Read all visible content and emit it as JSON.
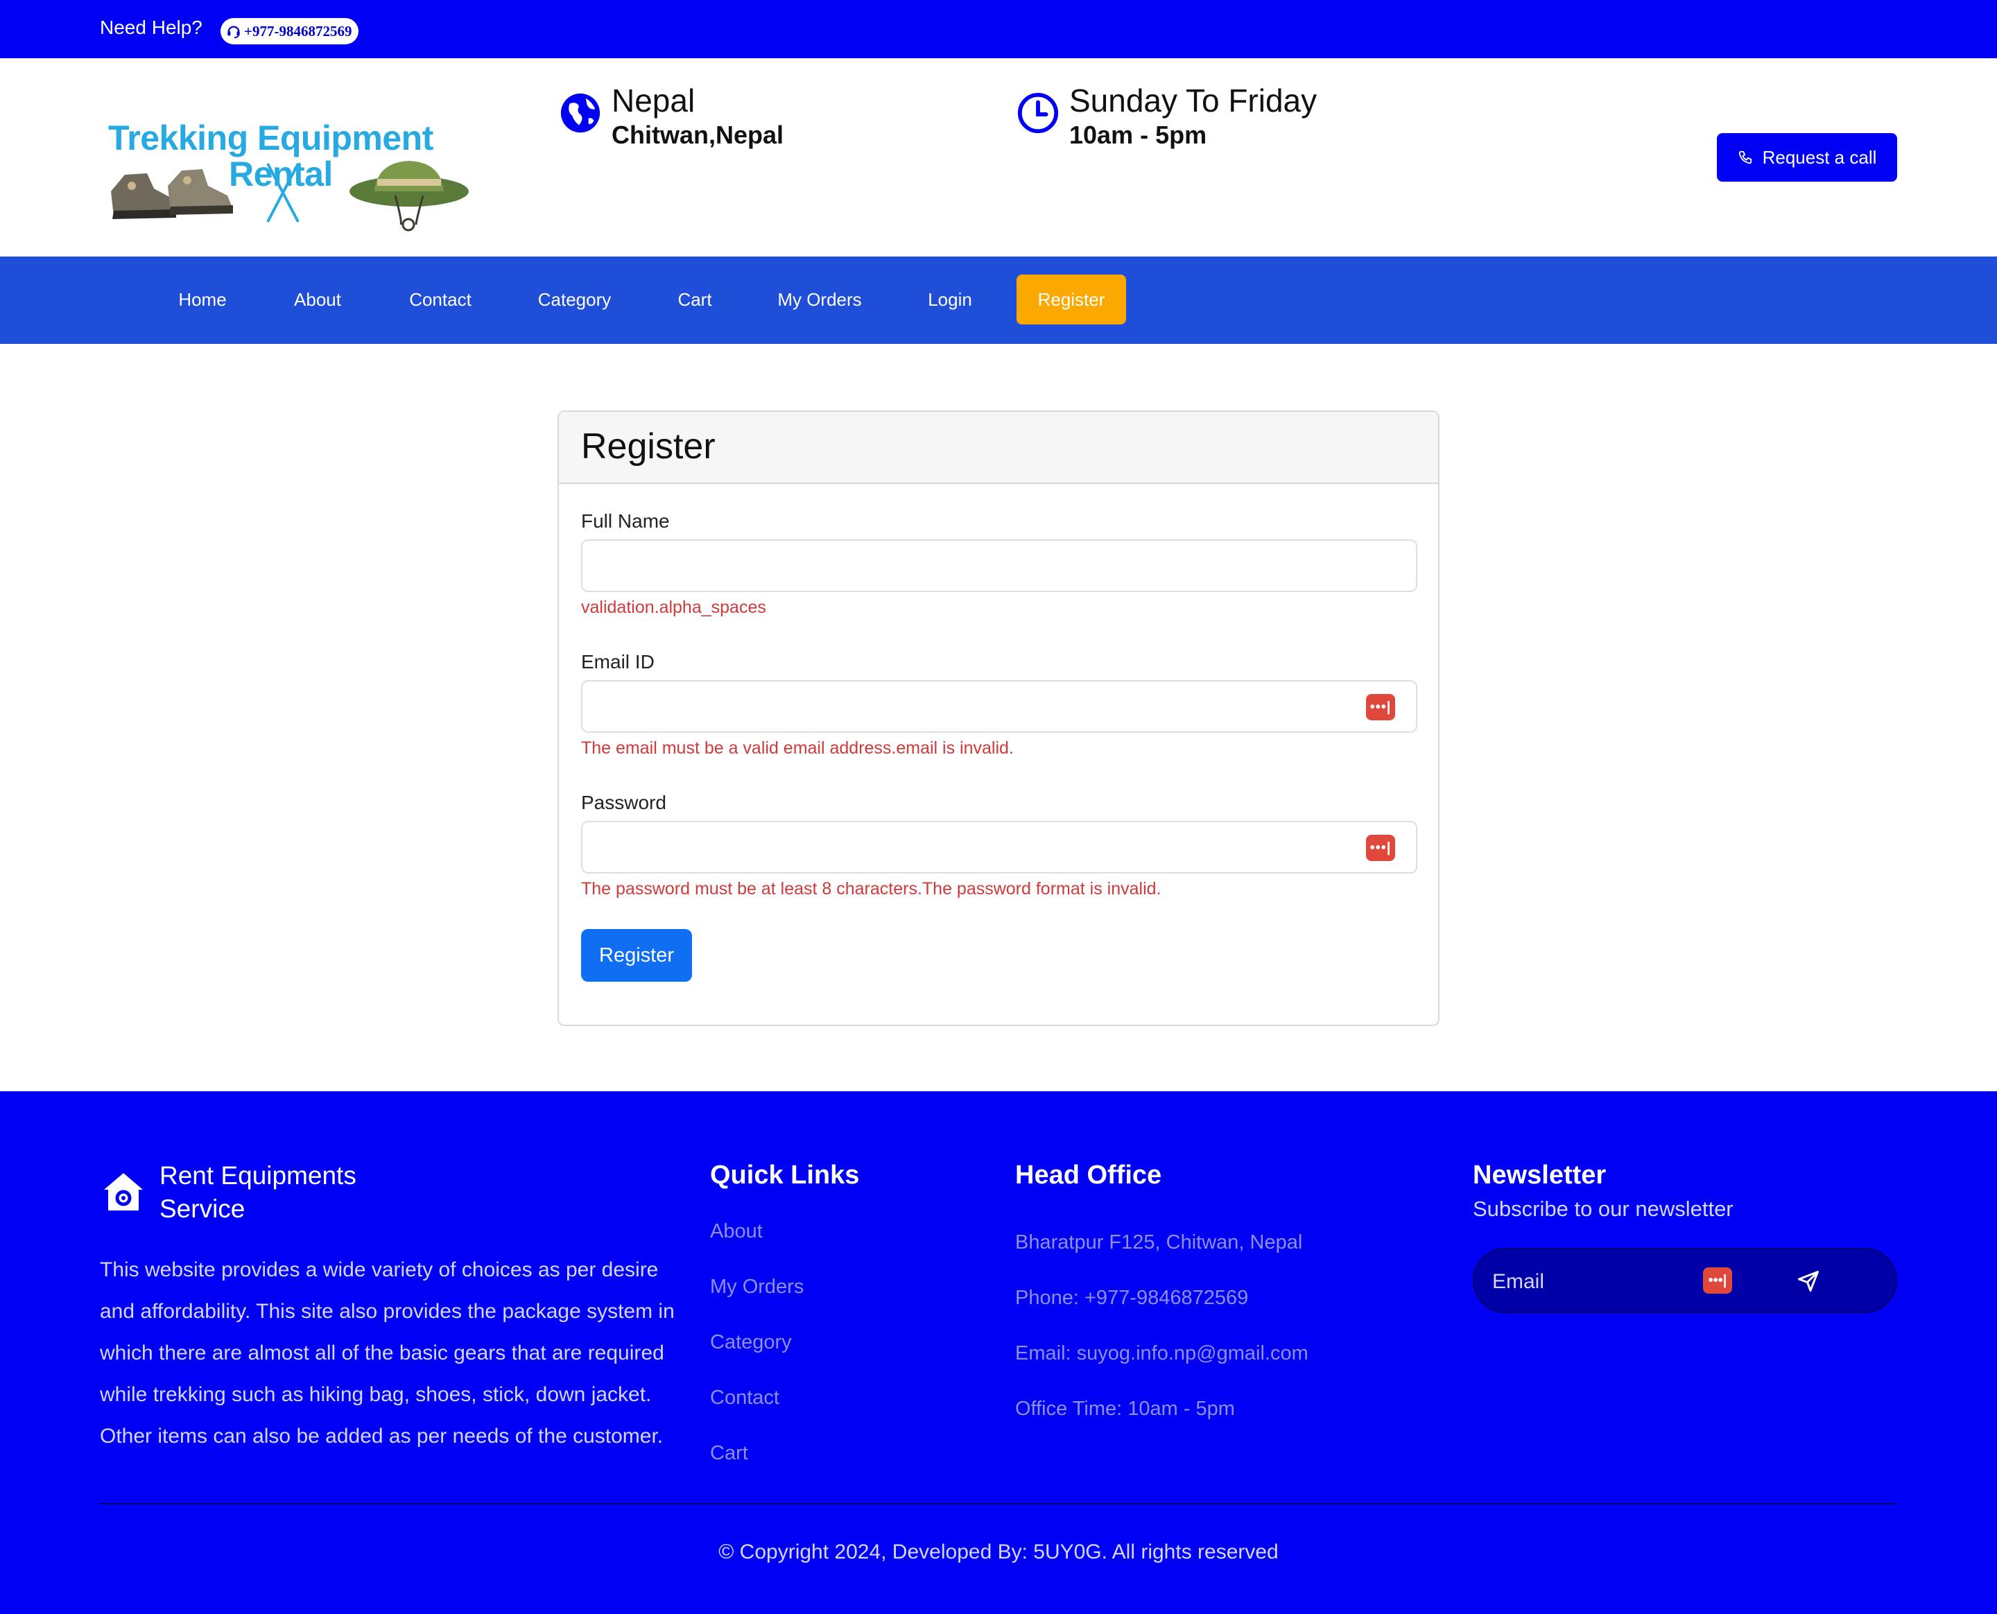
{
  "topbar": {
    "help_text": "Need Help?",
    "phone": "+977-9846872569"
  },
  "header": {
    "logo_line1": "Trekking Equipment",
    "logo_line2": "Rental",
    "location": {
      "title": "Nepal",
      "subtitle": "Chitwan,Nepal",
      "icon": "globe-icon"
    },
    "hours": {
      "title": "Sunday To Friday",
      "subtitle": "10am - 5pm",
      "icon": "clock-icon"
    },
    "request_call_label": "Request a call"
  },
  "nav": {
    "items": [
      {
        "label": "Home"
      },
      {
        "label": "About"
      },
      {
        "label": "Contact"
      },
      {
        "label": "Category"
      },
      {
        "label": "Cart"
      },
      {
        "label": "My Orders"
      },
      {
        "label": "Login"
      },
      {
        "label": "Register",
        "active": true
      }
    ]
  },
  "form": {
    "title": "Register",
    "full_name": {
      "label": "Full Name",
      "value": "",
      "error": "validation.alpha_spaces"
    },
    "email": {
      "label": "Email ID",
      "value": "",
      "error": "The email must be a valid email address.email is invalid."
    },
    "password": {
      "label": "Password",
      "value": "",
      "error": "The password must be at least 8 characters.The password format is invalid."
    },
    "submit_label": "Register",
    "password_manager_icon": "•••|"
  },
  "footer": {
    "brand_line1": "Rent Equipments",
    "brand_line2": "Service",
    "about": "This website provides a wide variety of choices as per desire and affordability. This site also provides the package system in which there are almost all of the basic gears that are required while trekking such as hiking bag, shoes, stick, down jacket. Other items can also be added as per needs of the customer.",
    "quick_links_title": "Quick Links",
    "quick_links": [
      "About",
      "My Orders",
      "Category",
      "Contact",
      "Cart"
    ],
    "head_office_title": "Head Office",
    "head_office": [
      "Bharatpur F125, Chitwan, Nepal",
      "Phone: +977-9846872569",
      "Email: suyog.info.np@gmail.com",
      "Office Time: 10am - 5pm"
    ],
    "newsletter_title": "Newsletter",
    "newsletter_subtitle": "Subscribe to our newsletter",
    "newsletter_placeholder": "Email",
    "copyright": "© Copyright 2024, Developed By: 5UY0G. All rights reserved"
  },
  "colors": {
    "primary_blue": "#0000f5",
    "nav_blue": "#1f4fd8",
    "active_orange": "#fba900",
    "button_blue": "#0f6ef2",
    "error_red": "#cf3a3a"
  }
}
